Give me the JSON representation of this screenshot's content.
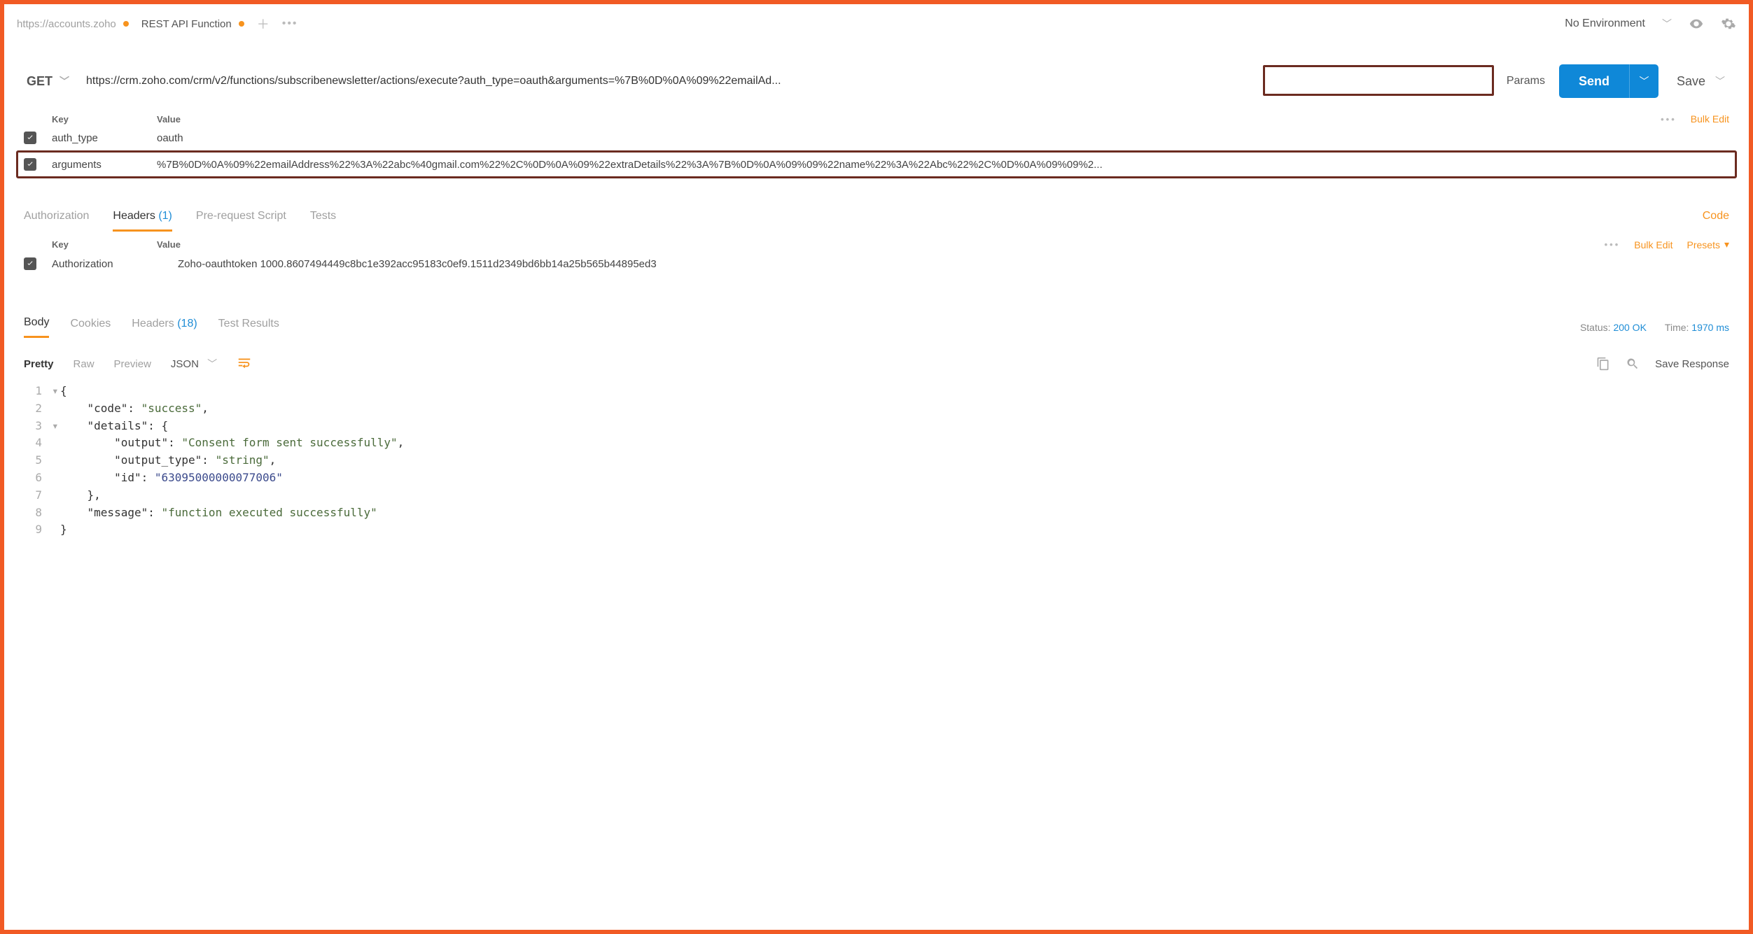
{
  "topbar": {
    "tabs": [
      {
        "label": "https://accounts.zoho",
        "modified": true,
        "active": false
      },
      {
        "label": "REST API Function",
        "modified": true,
        "active": true
      }
    ],
    "environment": "No Environment"
  },
  "request": {
    "method": "GET",
    "url": "https://crm.zoho.com/crm/v2/functions/subscribenewsletter/actions/execute?auth_type=oauth&arguments=%7B%0D%0A%09%22emailAd...",
    "params_label": "Params",
    "send_label": "Send",
    "save_label": "Save"
  },
  "params": {
    "headers": {
      "key": "Key",
      "value": "Value"
    },
    "bulk_edit": "Bulk Edit",
    "rows": [
      {
        "checked": true,
        "key": "auth_type",
        "value": "oauth",
        "highlight": false
      },
      {
        "checked": true,
        "key": "arguments",
        "value": "%7B%0D%0A%09%22emailAddress%22%3A%22abc%40gmail.com%22%2C%0D%0A%09%22extraDetails%22%3A%7B%0D%0A%09%09%22name%22%3A%22Abc%22%2C%0D%0A%09%09%2...",
        "highlight": true
      }
    ]
  },
  "subtabs": {
    "items": [
      {
        "label": "Authorization",
        "count": null,
        "active": false
      },
      {
        "label": "Headers",
        "count": "(1)",
        "active": true
      },
      {
        "label": "Pre-request Script",
        "count": null,
        "active": false
      },
      {
        "label": "Tests",
        "count": null,
        "active": false
      }
    ],
    "code_label": "Code"
  },
  "headers": {
    "col_key": "Key",
    "col_value": "Value",
    "bulk_edit": "Bulk Edit",
    "presets": "Presets",
    "rows": [
      {
        "checked": true,
        "key": "Authorization",
        "value": "Zoho-oauthtoken 1000.8607494449c8bc1e392acc95183c0ef9.1511d2349bd6bb14a25b565b44895ed3"
      }
    ]
  },
  "response": {
    "tabs": [
      {
        "label": "Body",
        "count": null,
        "active": true
      },
      {
        "label": "Cookies",
        "count": null,
        "active": false
      },
      {
        "label": "Headers",
        "count": "(18)",
        "active": false
      },
      {
        "label": "Test Results",
        "count": null,
        "active": false
      }
    ],
    "status_label": "Status:",
    "status_value": "200 OK",
    "time_label": "Time:",
    "time_value": "1970 ms"
  },
  "body_toolbar": {
    "modes": [
      "Pretty",
      "Raw",
      "Preview"
    ],
    "active_mode": "Pretty",
    "format": "JSON",
    "save_response": "Save Response"
  },
  "body_json": {
    "lines": [
      {
        "n": "1",
        "fold": true,
        "text_pre": "{",
        "kind": "plain"
      },
      {
        "n": "2",
        "fold": false,
        "text_pre": "    \"code\": ",
        "str": "\"success\"",
        "tail": ","
      },
      {
        "n": "3",
        "fold": true,
        "text_pre": "    \"details\": {",
        "kind": "plain"
      },
      {
        "n": "4",
        "fold": false,
        "text_pre": "        \"output\": ",
        "str": "\"Consent form sent successfully\"",
        "tail": ","
      },
      {
        "n": "5",
        "fold": false,
        "text_pre": "        \"output_type\": ",
        "str": "\"string\"",
        "tail": ","
      },
      {
        "n": "6",
        "fold": false,
        "text_pre": "        \"id\": ",
        "num": "\"63095000000077006\"",
        "tail": ""
      },
      {
        "n": "7",
        "fold": false,
        "text_pre": "    },",
        "kind": "plain"
      },
      {
        "n": "8",
        "fold": false,
        "text_pre": "    \"message\": ",
        "str": "\"function executed successfully\"",
        "tail": ""
      },
      {
        "n": "9",
        "fold": false,
        "text_pre": "}",
        "kind": "plain"
      }
    ]
  }
}
